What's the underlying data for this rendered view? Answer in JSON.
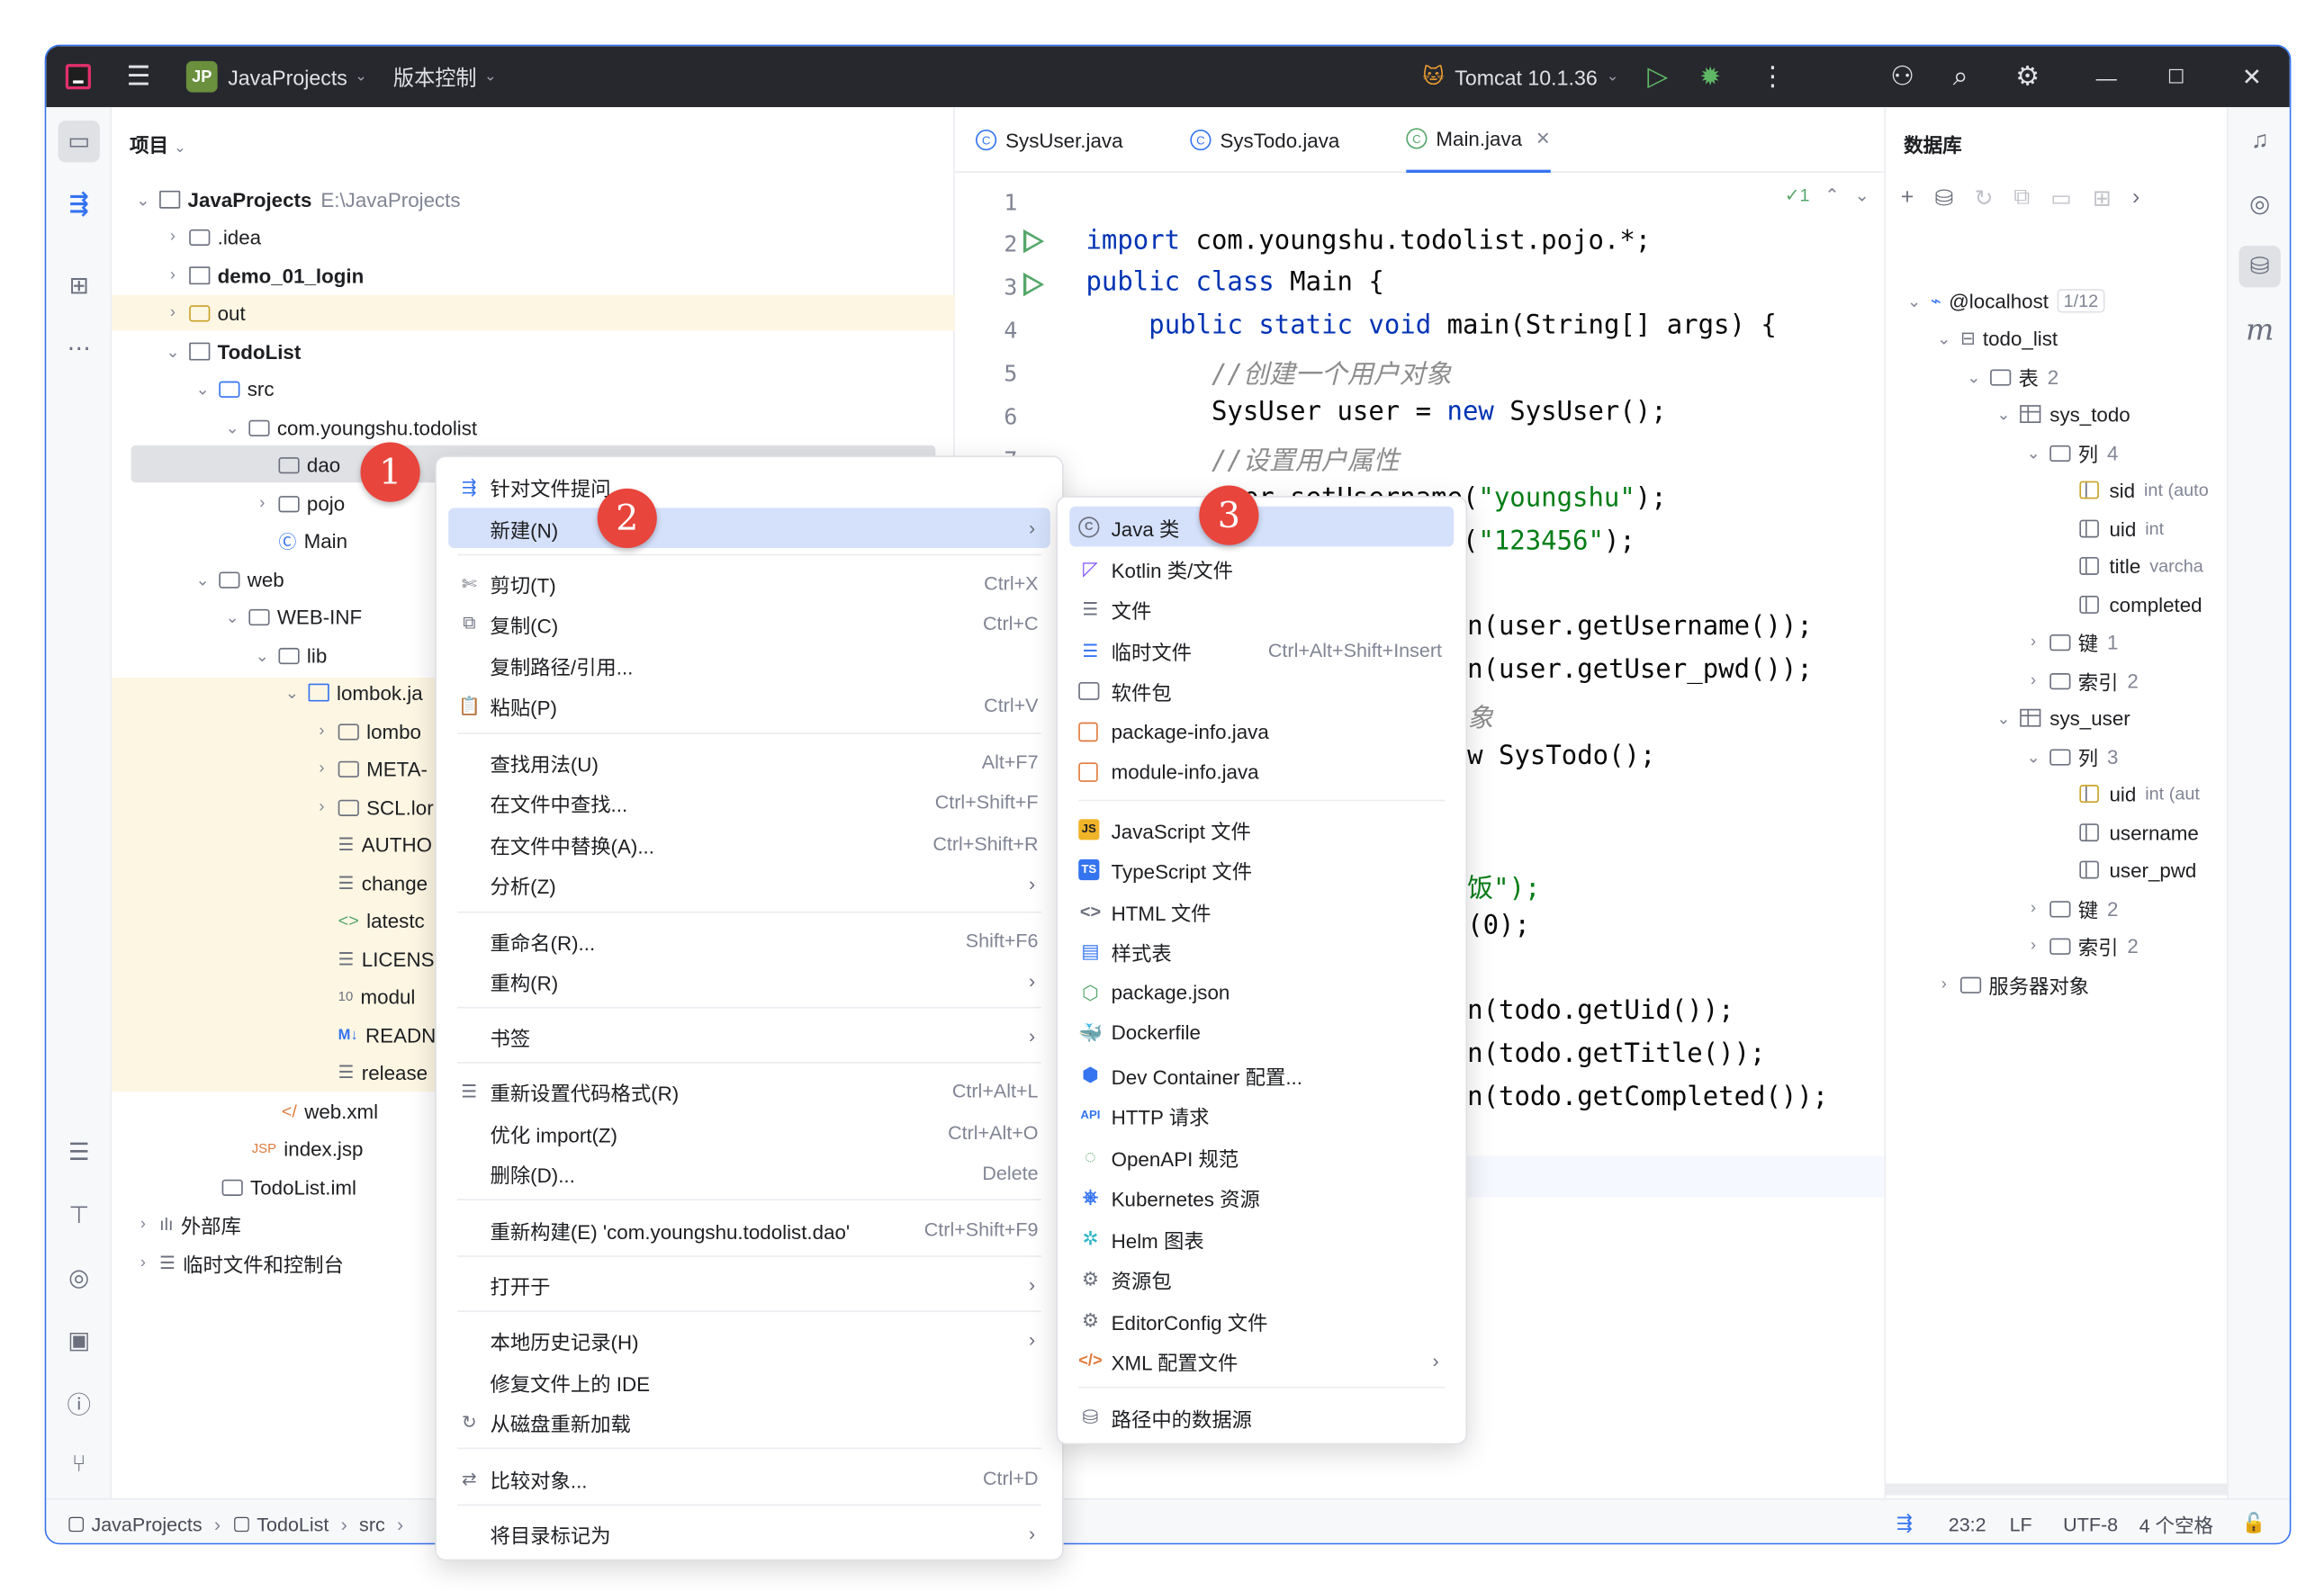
{
  "titlebar": {
    "project_badge": "JP",
    "project_name": "JavaProjects",
    "vcs": "版本控制",
    "run_config": "Tomcat 10.1.36"
  },
  "project_panel": {
    "title": "项目",
    "tree": [
      {
        "label": "JavaProjects",
        "hint": "E:\\JavaProjects"
      },
      {
        "label": ".idea"
      },
      {
        "label": "demo_01_login"
      },
      {
        "label": "out"
      },
      {
        "label": "TodoList"
      },
      {
        "label": "src"
      },
      {
        "label": "com.youngshu.todolist"
      },
      {
        "label": "dao"
      },
      {
        "label": "pojo"
      },
      {
        "label": "Main"
      },
      {
        "label": "web"
      },
      {
        "label": "WEB-INF"
      },
      {
        "label": "lib"
      },
      {
        "label": "lombok.ja"
      },
      {
        "label": "lombo"
      },
      {
        "label": "META-"
      },
      {
        "label": "SCL.lor"
      },
      {
        "label": "AUTHO"
      },
      {
        "label": "change"
      },
      {
        "label": "latestc"
      },
      {
        "label": "LICENS"
      },
      {
        "label": "modul"
      },
      {
        "label": "READN"
      },
      {
        "label": "release"
      },
      {
        "label": "web.xml"
      },
      {
        "label": "index.jsp"
      },
      {
        "label": "TodoList.iml"
      },
      {
        "label": "外部库"
      },
      {
        "label": "临时文件和控制台"
      }
    ]
  },
  "editor": {
    "tabs": [
      {
        "label": "SysUser.java"
      },
      {
        "label": "SysTodo.java"
      },
      {
        "label": "Main.java"
      }
    ],
    "line_numbers": [
      "1",
      "2",
      "3",
      "4",
      "5",
      "6",
      "7"
    ],
    "inspection_count": "1",
    "visible_fragments": {
      "l9": "n(user.getUsername());",
      "l10": "n(user.getUser_pwd());",
      "l11": "象",
      "l12": "w SysTodo();",
      "l15": "饭\");",
      "l16": "(0);",
      "l18": "n(todo.getUid());",
      "l19": "n(todo.getTitle());",
      "l20": "n(todo.getCompleted());"
    }
  },
  "database_panel": {
    "title": "数据库",
    "tree": [
      {
        "label": "@localhost",
        "hint": "1/12"
      },
      {
        "label": "todo_list"
      },
      {
        "label": "表",
        "hint": "2"
      },
      {
        "label": "sys_todo"
      },
      {
        "label": "列",
        "hint": "4"
      },
      {
        "label": "sid",
        "hint": "int (auto"
      },
      {
        "label": "uid",
        "hint": "int"
      },
      {
        "label": "title",
        "hint": "varcha"
      },
      {
        "label": "completed"
      },
      {
        "label": "键",
        "hint": "1"
      },
      {
        "label": "索引",
        "hint": "2"
      },
      {
        "label": "sys_user"
      },
      {
        "label": "列",
        "hint": "3"
      },
      {
        "label": "uid",
        "hint": "int (aut"
      },
      {
        "label": "username"
      },
      {
        "label": "user_pwd"
      },
      {
        "label": "键",
        "hint": "2"
      },
      {
        "label": "索引",
        "hint": "2"
      },
      {
        "label": "服务器对象"
      }
    ]
  },
  "context_menu": {
    "items": [
      {
        "label": "针对文件提问"
      },
      {
        "label": "新建(N)"
      },
      {
        "label": "剪切(T)",
        "shortcut": "Ctrl+X"
      },
      {
        "label": "复制(C)",
        "shortcut": "Ctrl+C"
      },
      {
        "label": "复制路径/引用..."
      },
      {
        "label": "粘贴(P)",
        "shortcut": "Ctrl+V"
      },
      {
        "label": "查找用法(U)",
        "shortcut": "Alt+F7"
      },
      {
        "label": "在文件中查找...",
        "shortcut": "Ctrl+Shift+F"
      },
      {
        "label": "在文件中替换(A)...",
        "shortcut": "Ctrl+Shift+R"
      },
      {
        "label": "分析(Z)"
      },
      {
        "label": "重命名(R)...",
        "shortcut": "Shift+F6"
      },
      {
        "label": "重构(R)"
      },
      {
        "label": "书签"
      },
      {
        "label": "重新设置代码格式(R)",
        "shortcut": "Ctrl+Alt+L"
      },
      {
        "label": "优化 import(Z)",
        "shortcut": "Ctrl+Alt+O"
      },
      {
        "label": "删除(D)...",
        "shortcut": "Delete"
      },
      {
        "label": "重新构建(E) 'com.youngshu.todolist.dao'",
        "shortcut": "Ctrl+Shift+F9"
      },
      {
        "label": "打开于"
      },
      {
        "label": "本地历史记录(H)"
      },
      {
        "label": "修复文件上的 IDE"
      },
      {
        "label": "从磁盘重新加载"
      },
      {
        "label": "比较对象...",
        "shortcut": "Ctrl+D"
      },
      {
        "label": "将目录标记为"
      }
    ]
  },
  "new_submenu": {
    "items": [
      {
        "label": "Java 类"
      },
      {
        "label": "Kotlin 类/文件"
      },
      {
        "label": "文件"
      },
      {
        "label": "临时文件",
        "shortcut": "Ctrl+Alt+Shift+Insert"
      },
      {
        "label": "软件包"
      },
      {
        "label": "package-info.java"
      },
      {
        "label": "module-info.java"
      },
      {
        "label": "JavaScript 文件"
      },
      {
        "label": "TypeScript 文件"
      },
      {
        "label": "HTML 文件"
      },
      {
        "label": "样式表"
      },
      {
        "label": "package.json"
      },
      {
        "label": "Dockerfile"
      },
      {
        "label": "Dev Container 配置..."
      },
      {
        "label": "HTTP 请求"
      },
      {
        "label": "OpenAPI 规范"
      },
      {
        "label": "Kubernetes 资源"
      },
      {
        "label": "Helm 图表"
      },
      {
        "label": "资源包"
      },
      {
        "label": "EditorConfig 文件"
      },
      {
        "label": "XML 配置文件"
      },
      {
        "label": "路径中的数据源"
      }
    ]
  },
  "markers": [
    "1",
    "2",
    "3"
  ],
  "statusbar": {
    "breadcrumbs": [
      "JavaProjects",
      "TodoList",
      "src"
    ],
    "position": "23:2",
    "line_sep": "LF",
    "encoding": "UTF-8",
    "indent": "4 个空格"
  },
  "colors": {
    "titlebar": "#27282e",
    "accent": "#3574f0",
    "highlight_yellow": "#fdf6e3",
    "menu_hover": "#d5e1fb",
    "marker_red": "#e8453c"
  }
}
